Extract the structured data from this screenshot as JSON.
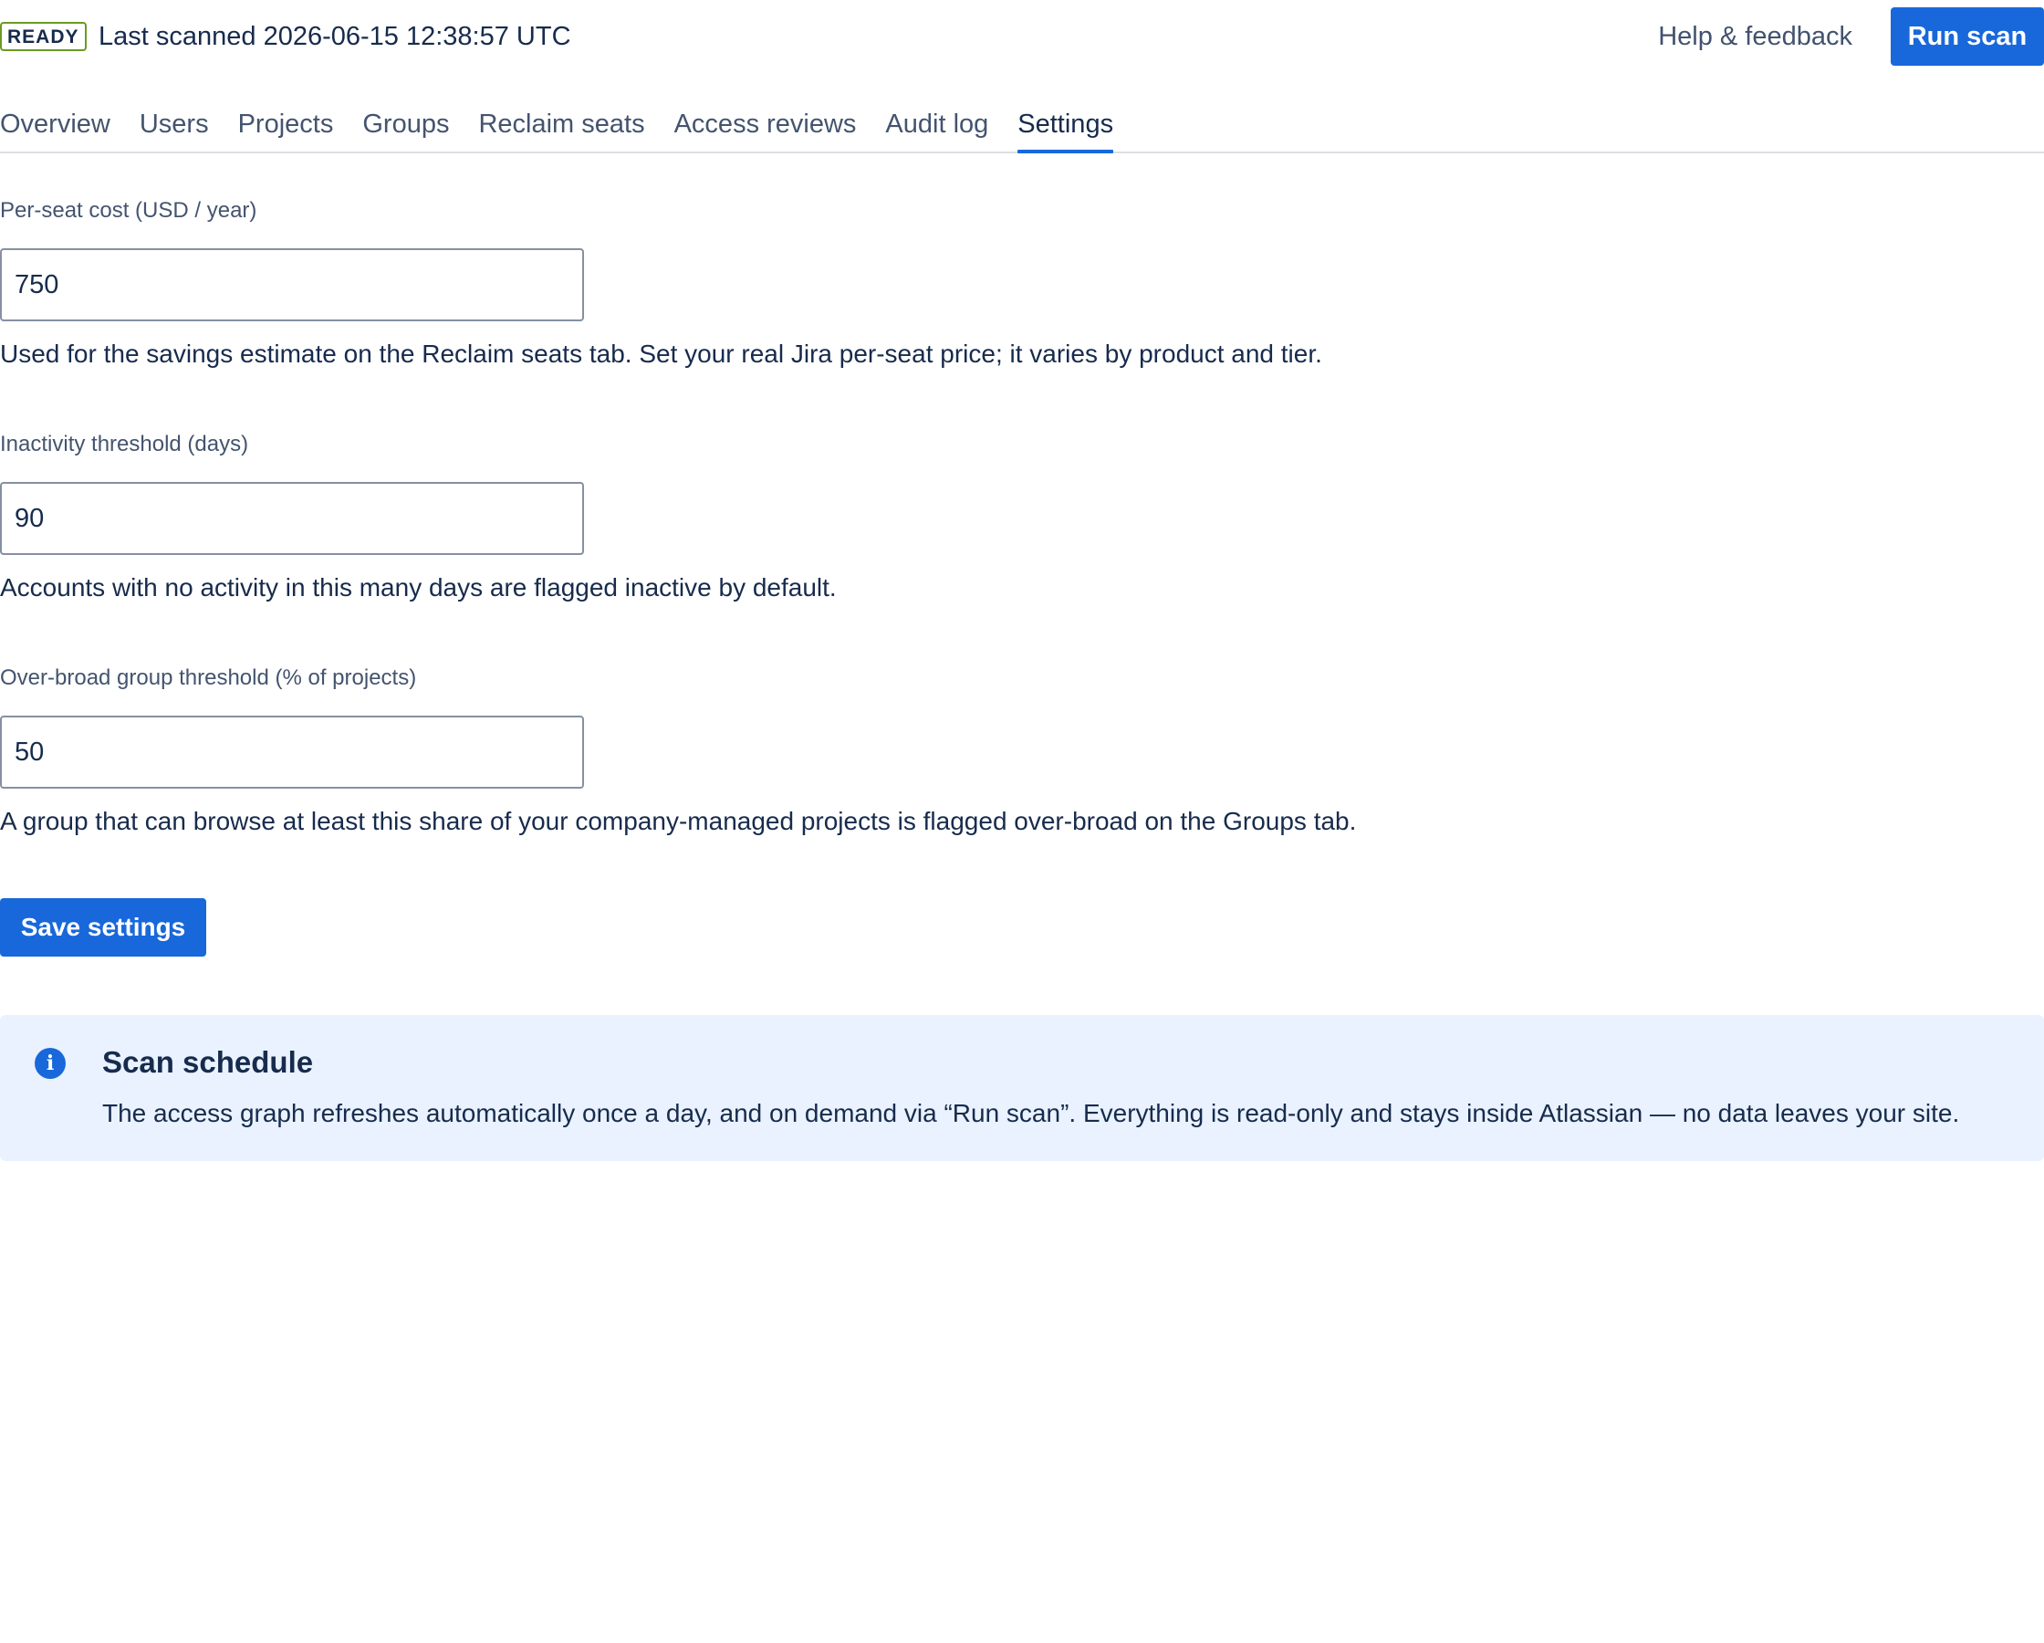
{
  "header": {
    "status_badge": "READY",
    "last_scanned": "Last scanned 2026-06-15 12:38:57 UTC",
    "help_link": "Help & feedback",
    "run_scan_label": "Run scan"
  },
  "tabs": [
    {
      "label": "Overview",
      "active": false
    },
    {
      "label": "Users",
      "active": false
    },
    {
      "label": "Projects",
      "active": false
    },
    {
      "label": "Groups",
      "active": false
    },
    {
      "label": "Reclaim seats",
      "active": false
    },
    {
      "label": "Access reviews",
      "active": false
    },
    {
      "label": "Audit log",
      "active": false
    },
    {
      "label": "Settings",
      "active": true
    }
  ],
  "settings": {
    "seat_cost": {
      "label": "Per-seat cost (USD / year)",
      "value": "750",
      "help": "Used for the savings estimate on the Reclaim seats tab. Set your real Jira per-seat price; it varies by product and tier."
    },
    "inactivity": {
      "label": "Inactivity threshold (days)",
      "value": "90",
      "help": "Accounts with no activity in this many days are flagged inactive by default."
    },
    "overbroad": {
      "label": "Over-broad group threshold (% of projects)",
      "value": "50",
      "help": "A group that can browse at least this share of your company-managed projects is flagged over-broad on the Groups tab."
    },
    "save_label": "Save settings"
  },
  "info": {
    "icon": "info-icon",
    "title": "Scan schedule",
    "body": "The access graph refreshes automatically once a day, and on demand via “Run scan”. Everything is read-only and stays inside Atlassian — no data leaves your site."
  },
  "colors": {
    "primary": "#1868db",
    "badge_border": "#6a9a23",
    "info_background": "#e9f2fe",
    "text": "#172b4d"
  }
}
